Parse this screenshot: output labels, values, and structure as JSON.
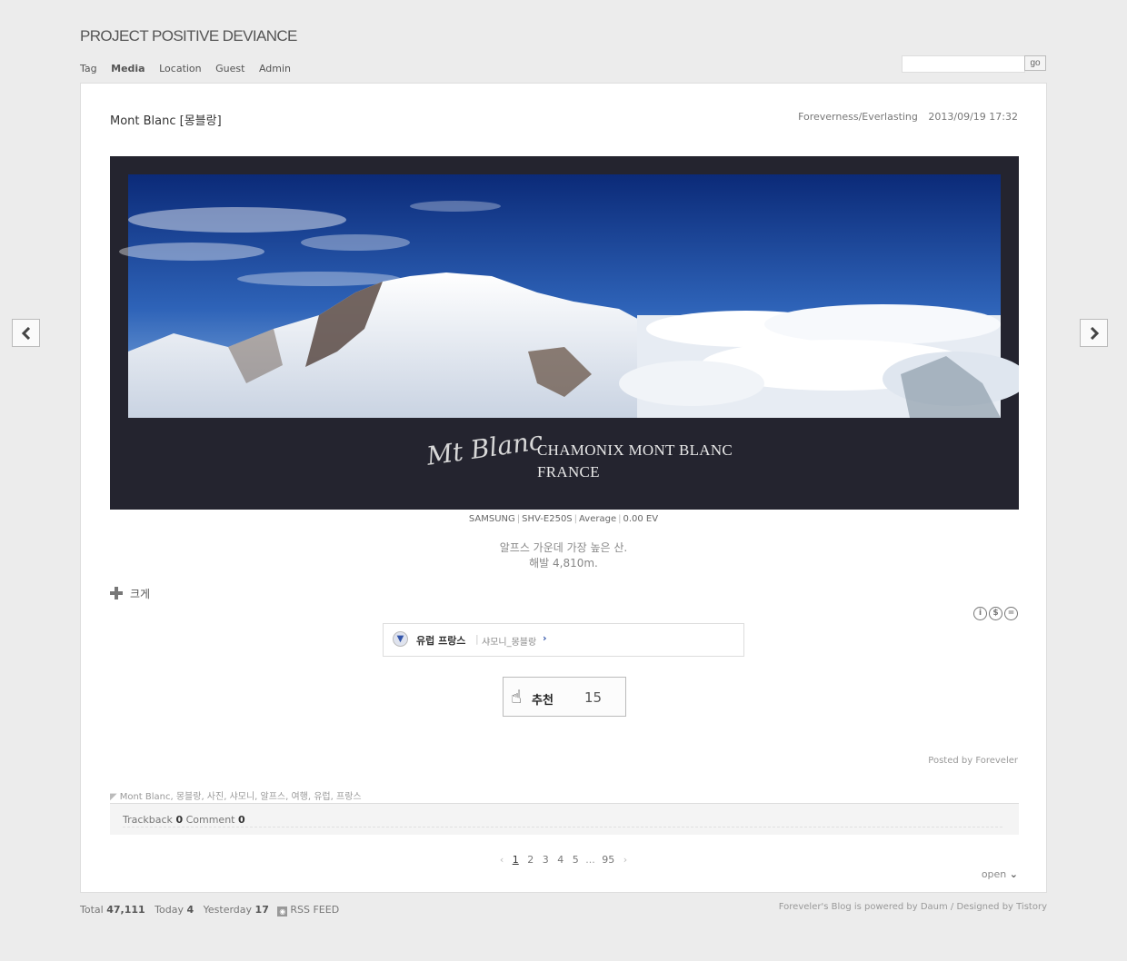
{
  "blog": {
    "title": "PROJECT POSITIVE DEVIANCE"
  },
  "nav": {
    "items": [
      "Tag",
      "Media",
      "Location",
      "Guest",
      "Admin"
    ]
  },
  "search": {
    "value": "",
    "button": "go"
  },
  "post": {
    "title": "Mont Blanc [몽블랑]",
    "category": "Foreverness/Everlasting",
    "date": "2013/09/19 17:32",
    "photo": {
      "script_text": "Mt Blanc",
      "caption_line1": "CHAMONIX MONT BLANC",
      "caption_line2": "FRANCE",
      "colors": {
        "frame": "#24242f",
        "sky_top": "#0b2a78",
        "sky_bottom": "#6da0dc"
      }
    },
    "exif": [
      "SAMSUNG",
      "SHV-E250S",
      "Average",
      "0.00 EV"
    ],
    "description_line1": "알프스 가운데 가장 높은 산.",
    "description_line2": "해발 4,810m.",
    "enlarge_label": "크게",
    "cc_icons": [
      "cc-by-icon",
      "cc-nc-icon",
      "cc-nd-icon"
    ],
    "location": {
      "main": "유럽 프랑스",
      "sub": "샤모니_몽블랑"
    },
    "recommend": {
      "label": "추천",
      "count": "15"
    },
    "posted_by": "Posted by Foreveler",
    "tags": "Mont Blanc, 몽블랑, 사진, 샤모니, 알프스, 여행, 유럽, 프랑스",
    "trackback": {
      "label": "Trackback",
      "count": "0",
      "comment_label": "Comment",
      "comment_count": "0"
    }
  },
  "pager": {
    "pages": [
      "1",
      "2",
      "3",
      "4",
      "5"
    ],
    "ellipsis": "...",
    "last": "95",
    "current": "1"
  },
  "open_label": "open",
  "footer": {
    "total_label": "Total",
    "total": "47,111",
    "today_label": "Today",
    "today": "4",
    "yesterday_label": "Yesterday",
    "yesterday": "17",
    "rss": "RSS FEED",
    "credit": "Foreveler's Blog is powered by Daum / Designed by Tistory"
  }
}
